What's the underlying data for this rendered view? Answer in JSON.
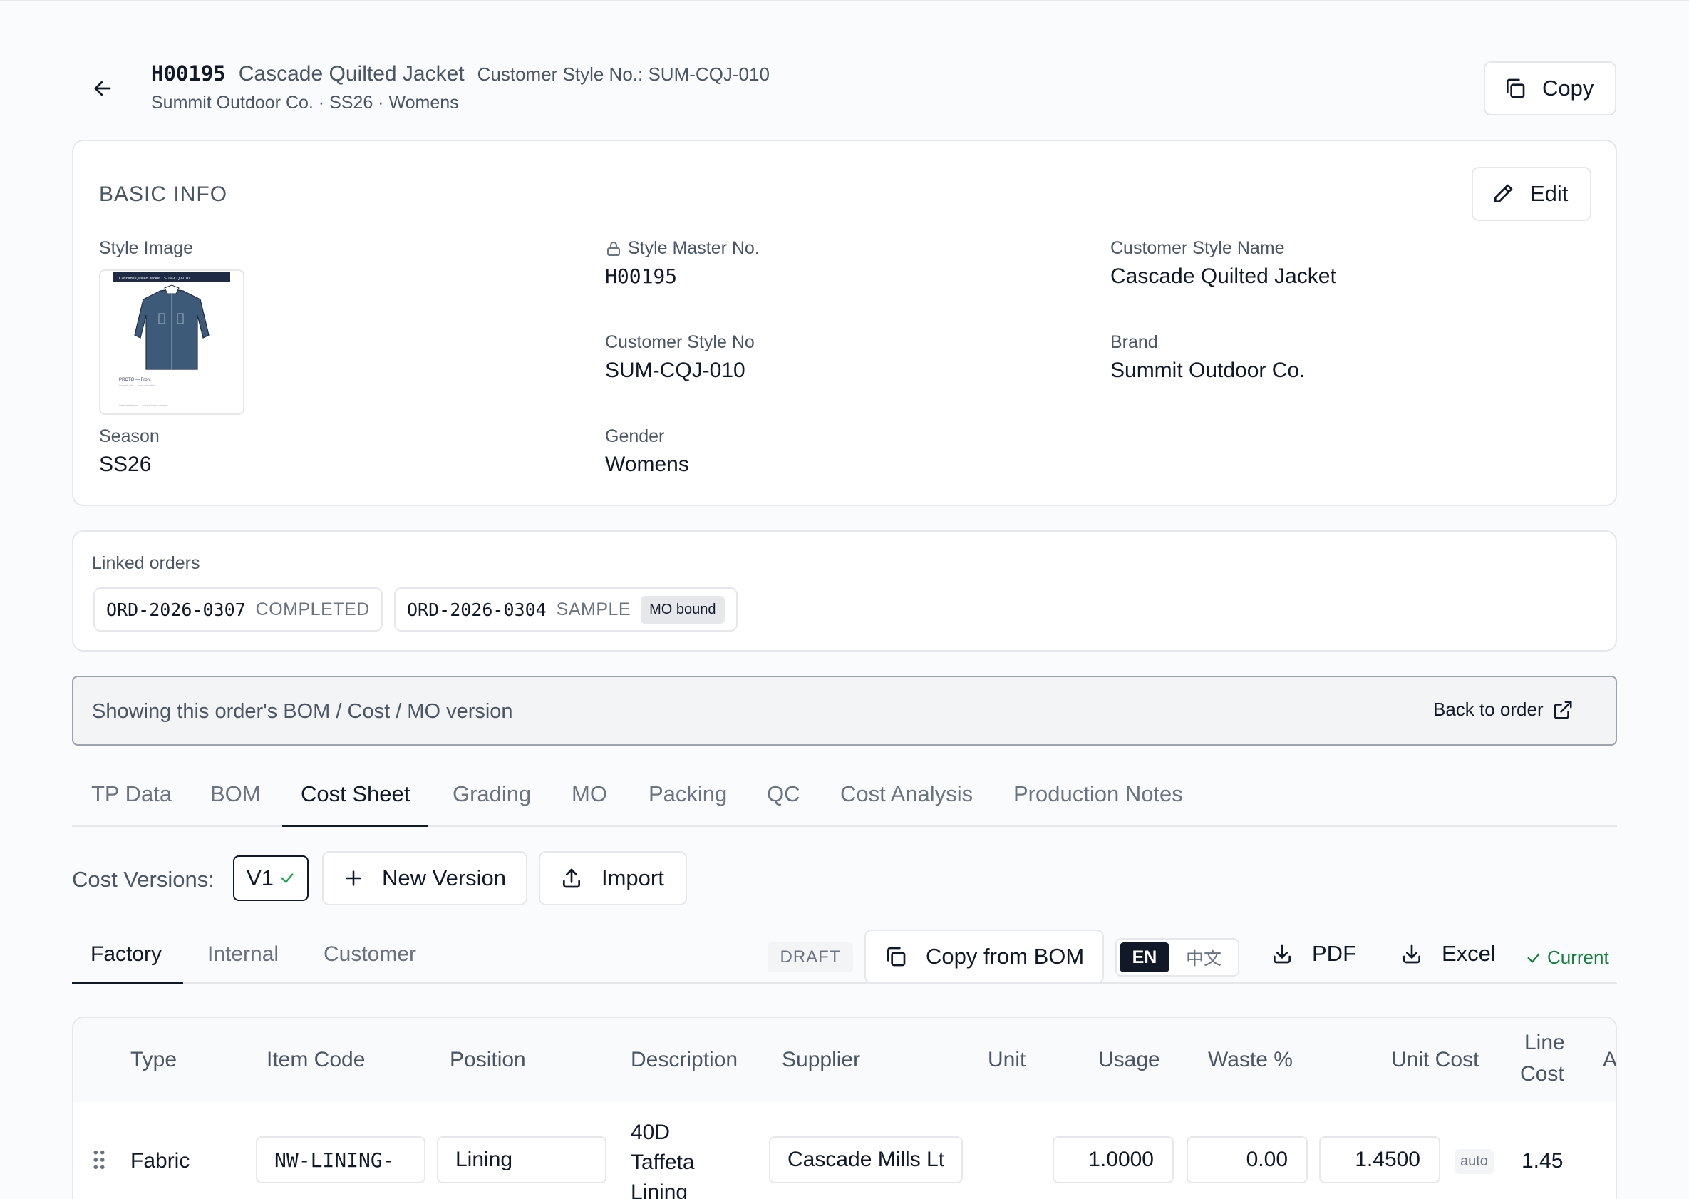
{
  "header": {
    "style_code": "H00195",
    "style_name": "Cascade Quilted Jacket",
    "customer_style_no": "Customer Style No.: SUM-CQJ-010",
    "subtitle": "Summit Outdoor Co. · SS26 · Womens",
    "copy_label": "Copy"
  },
  "basic_info": {
    "title": "BASIC INFO",
    "edit_label": "Edit",
    "style_image_label": "Style Image",
    "image_caption_top": "Cascade Quilted Jacket · SUM-CQJ-010",
    "image_caption_mid": "PROTO — Front",
    "image_caption_small": "Sample flat — front elevation",
    "image_caption_foot": "Internal reference — not production drawing",
    "style_master_label": "Style Master No.",
    "style_master_value": "H00195",
    "customer_style_name_label": "Customer Style Name",
    "customer_style_name_value": "Cascade Quilted Jacket",
    "customer_style_no_label": "Customer Style No",
    "customer_style_no_value": "SUM-CQJ-010",
    "brand_label": "Brand",
    "brand_value": "Summit Outdoor Co.",
    "season_label": "Season",
    "season_value": "SS26",
    "gender_label": "Gender",
    "gender_value": "Womens"
  },
  "linked_orders": {
    "label": "Linked orders",
    "orders": [
      {
        "no": "ORD-2026-0307",
        "status": "COMPLETED"
      },
      {
        "no": "ORD-2026-0304",
        "status": "SAMPLE",
        "badge": "MO bound"
      }
    ]
  },
  "banner": {
    "text": "Showing this order's BOM / Cost / MO version",
    "back_label": "Back to order"
  },
  "main_tabs": [
    "TP Data",
    "BOM",
    "Cost Sheet",
    "Grading",
    "MO",
    "Packing",
    "QC",
    "Cost Analysis",
    "Production Notes"
  ],
  "active_main_tab": "Cost Sheet",
  "cost_versions": {
    "label": "Cost Versions:",
    "current": "V1",
    "new_version_label": "New Version",
    "import_label": "Import"
  },
  "sub_tabs": [
    "Factory",
    "Internal",
    "Customer"
  ],
  "active_sub_tab": "Factory",
  "toolbar": {
    "status": "DRAFT",
    "copy_from_bom": "Copy from BOM",
    "lang_en": "EN",
    "lang_zh": "中文",
    "pdf": "PDF",
    "excel": "Excel",
    "current": "Current"
  },
  "table": {
    "headers": {
      "type": "Type",
      "item_code": "Item Code",
      "position": "Position",
      "description": "Description",
      "supplier": "Supplier",
      "unit": "Unit",
      "usage": "Usage",
      "waste": "Waste %",
      "unit_cost": "Unit Cost",
      "line_cost_1": "Line",
      "line_cost_2": "Cost",
      "next": "A"
    },
    "rows": [
      {
        "type": "Fabric",
        "item_code": "NW-LINING-",
        "position": "Lining",
        "description": [
          "40D",
          "Taffeta",
          "Lining"
        ],
        "supplier": "Cascade Mills Lt",
        "unit": "",
        "usage": "1.0000",
        "waste": "0.00",
        "unit_cost": "1.4500",
        "unit_cost_badge": "auto",
        "line_cost": "1.45"
      }
    ]
  },
  "colors": {
    "accent_dark": "#111827",
    "muted": "#6b7280",
    "success": "#15803d",
    "jacket": "#3d5a78"
  }
}
